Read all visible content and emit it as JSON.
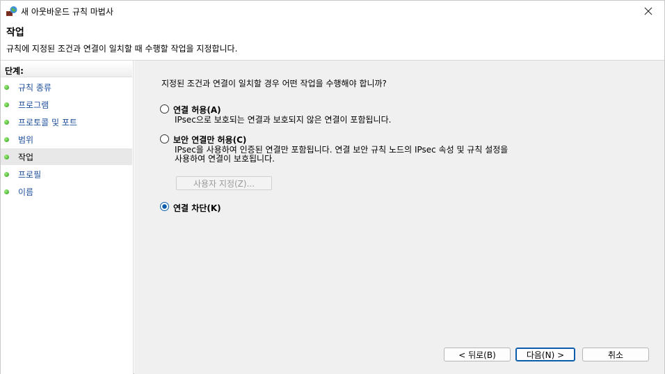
{
  "window": {
    "title": "새 아웃바운드 규칙 마법사",
    "close_icon": "close-icon"
  },
  "header": {
    "title": "작업",
    "description": "규칙에 지정된 조건과 연결이 일치할 때 수행할 작업을 지정합니다."
  },
  "steps": {
    "label": "단계:",
    "items": [
      {
        "label": "규칙 종류",
        "current": false
      },
      {
        "label": "프로그램",
        "current": false
      },
      {
        "label": "프로토콜 및 포트",
        "current": false
      },
      {
        "label": "범위",
        "current": false
      },
      {
        "label": "작업",
        "current": true
      },
      {
        "label": "프로필",
        "current": false
      },
      {
        "label": "이름",
        "current": false
      }
    ]
  },
  "main": {
    "question": "지정된 조건과 연결이 일치할 경우 어떤 작업을 수행해야 합니까?",
    "options": [
      {
        "label": "연결 허용(A)",
        "description": "IPsec으로 보호되는 연결과 보호되지 않은 연결이 포함됩니다.",
        "checked": false
      },
      {
        "label": "보안 연결만 허용(C)",
        "description_line1": "IPsec을 사용하여 인증된 연결만 포함됩니다. 연결 보안 규칙 노드의 IPsec 속성 및 규칙 설정을",
        "description_line2": "사용하여 연결이 보호됩니다.",
        "checked": false
      },
      {
        "label": "연결 차단(K)",
        "checked": true
      }
    ],
    "customize_label": "사용자 지정(Z)..."
  },
  "buttons": {
    "back": "< 뒤로(B)",
    "next": "다음(N) >",
    "cancel": "취소"
  },
  "colors": {
    "accent": "#0b5cad",
    "step_link": "#1f4e9c",
    "step_bullet": "#2f9a1d"
  }
}
